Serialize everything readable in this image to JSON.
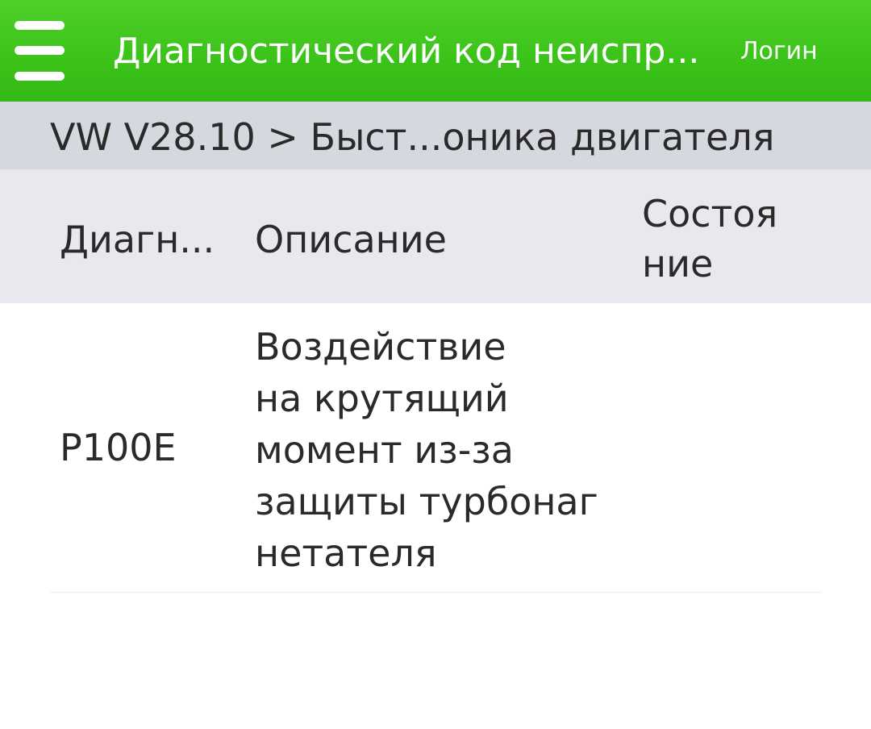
{
  "header": {
    "title": "Диагностический код неиспр...",
    "login_label": "Логин",
    "menu_icon": "hamburger-menu-icon"
  },
  "breadcrumb": {
    "text": "VW V28.10 > Быст...оника двигателя"
  },
  "table": {
    "columns": {
      "code": "Диагн...",
      "description": "Описание",
      "state_line1": "Состоя",
      "state_line2": "ние"
    },
    "rows": [
      {
        "code": "P100E",
        "description_lines": [
          "Воздействие",
          "на крутящий",
          "момент из-за",
          "защиты турбонаг",
          "нетателя"
        ],
        "state": ""
      }
    ]
  },
  "colors": {
    "topbar": "#3cc41a",
    "breadcrumb_bg": "#d6d8df",
    "table_header_bg": "#e9e8ee"
  }
}
